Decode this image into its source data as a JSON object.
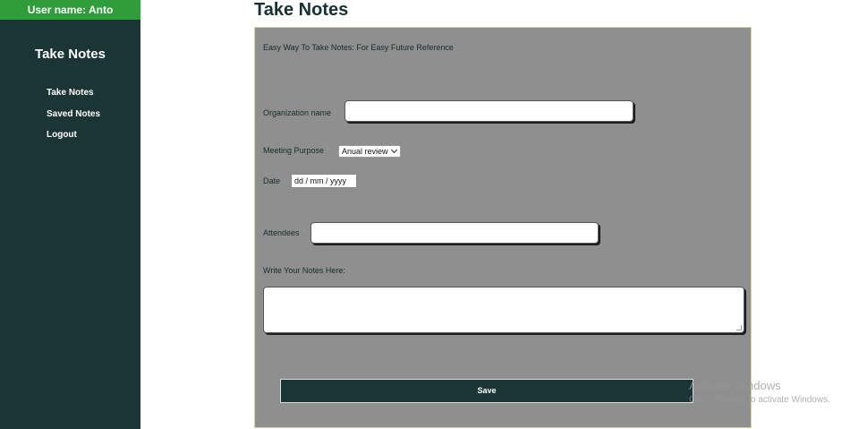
{
  "sidebar": {
    "user_label": "User name: Anto",
    "brand": "Take Notes",
    "items": [
      {
        "label": "Take Notes"
      },
      {
        "label": "Saved Notes"
      },
      {
        "label": "Logout"
      }
    ]
  },
  "main": {
    "title": "Take Notes",
    "form": {
      "subtitle": "Easy Way To Take Notes: For Easy Future Reference",
      "required_marker": "*",
      "organization": {
        "label": "Organization name",
        "value": ""
      },
      "purpose": {
        "label": "Meeting Purpose",
        "selected": "Anual review"
      },
      "date": {
        "label": "Date",
        "placeholder": "dd / mm / yyyy"
      },
      "attendees": {
        "label": "Attendees",
        "value": ""
      },
      "notes": {
        "label": "Write Your Notes Here:",
        "value": ""
      },
      "save_label": "Save"
    }
  },
  "watermark": {
    "line1": "Activate Windows",
    "line2": "Go to Settings to activate Windows."
  }
}
